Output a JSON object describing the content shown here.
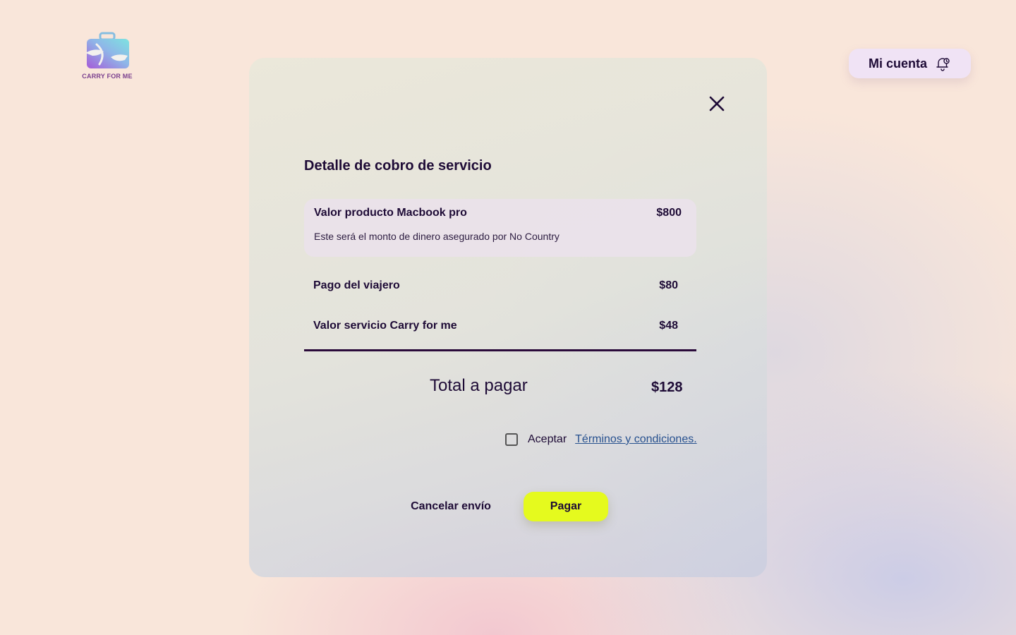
{
  "logo": {
    "text": "CARRY FOR ME"
  },
  "header": {
    "account_label": "Mi cuenta"
  },
  "modal": {
    "title": "Detalle de cobro de servicio",
    "product": {
      "label": "Valor producto Macbook pro",
      "price": "$800",
      "note": "Este será el monto de dinero asegurado por No Country"
    },
    "rows": [
      {
        "label": "Pago del viajero",
        "value": "$80"
      },
      {
        "label": "Valor servicio Carry for me",
        "value": "$48"
      }
    ],
    "total": {
      "label": "Total a pagar",
      "value": "$128"
    },
    "terms": {
      "checked": false,
      "accept_label": "Aceptar",
      "link_label": "Términos y condiciones."
    },
    "buttons": {
      "cancel_label": "Cancelar envío",
      "pay_label": "Pagar"
    }
  },
  "colors": {
    "pay_button": "#e5fa1e",
    "text_primary": "#1e0b36",
    "link": "#27518f",
    "account_pill": "#f0e3f5"
  }
}
